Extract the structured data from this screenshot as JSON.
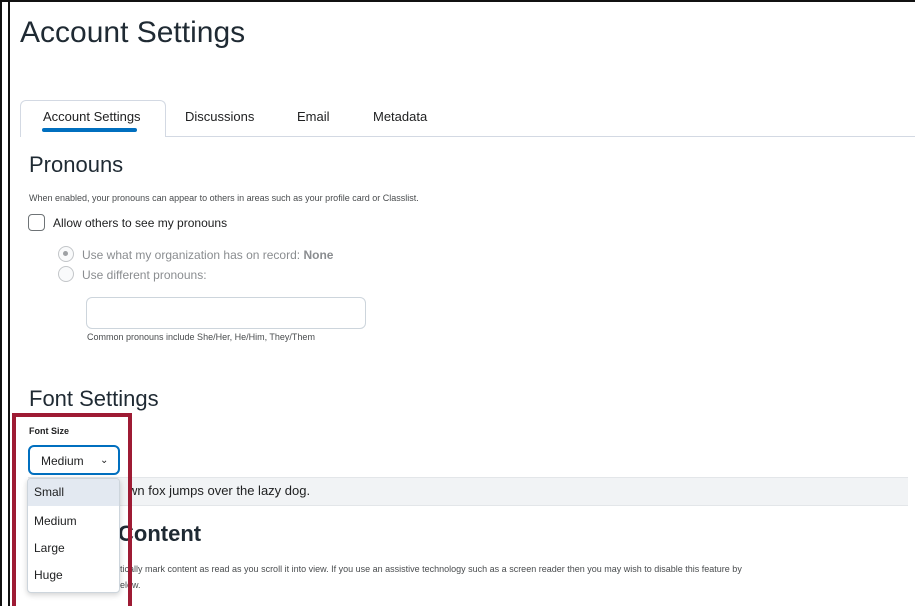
{
  "page": {
    "title": "Account Settings"
  },
  "tabs": [
    {
      "label": "Account Settings",
      "active": true
    },
    {
      "label": "Discussions",
      "active": false
    },
    {
      "label": "Email",
      "active": false
    },
    {
      "label": "Metadata",
      "active": false
    }
  ],
  "pronouns": {
    "heading": "Pronouns",
    "help": "When enabled, your pronouns can appear to others in areas such as your profile card or Classlist.",
    "checkbox_label": "Allow others to see my pronouns",
    "checkbox_checked": false,
    "radio_org_label": "Use what my organization has on record: ",
    "radio_org_value": "None",
    "radio_org_selected": true,
    "radio_diff_label": "Use different pronouns:",
    "input_value": "",
    "input_hint": "Common pronouns include She/Her, He/Him, They/Them"
  },
  "font_settings": {
    "heading": "Font Settings",
    "size_label": "Font Size",
    "selected": "Medium",
    "options": [
      "Small",
      "Medium",
      "Large",
      "Huge"
    ],
    "highlighted_option": "Small",
    "preview_visible": "wn fox jumps over the lazy dog."
  },
  "content": {
    "heading_visible": "Content",
    "desc_line1_visible": "tically mark content as read as you scroll it into view. If you use an assistive technology such as a screen reader then you may wish to disable this feature by",
    "desc_line2_visible": "elow."
  },
  "colors": {
    "accent": "#006fbf",
    "highlight_border": "#9e1b34"
  }
}
